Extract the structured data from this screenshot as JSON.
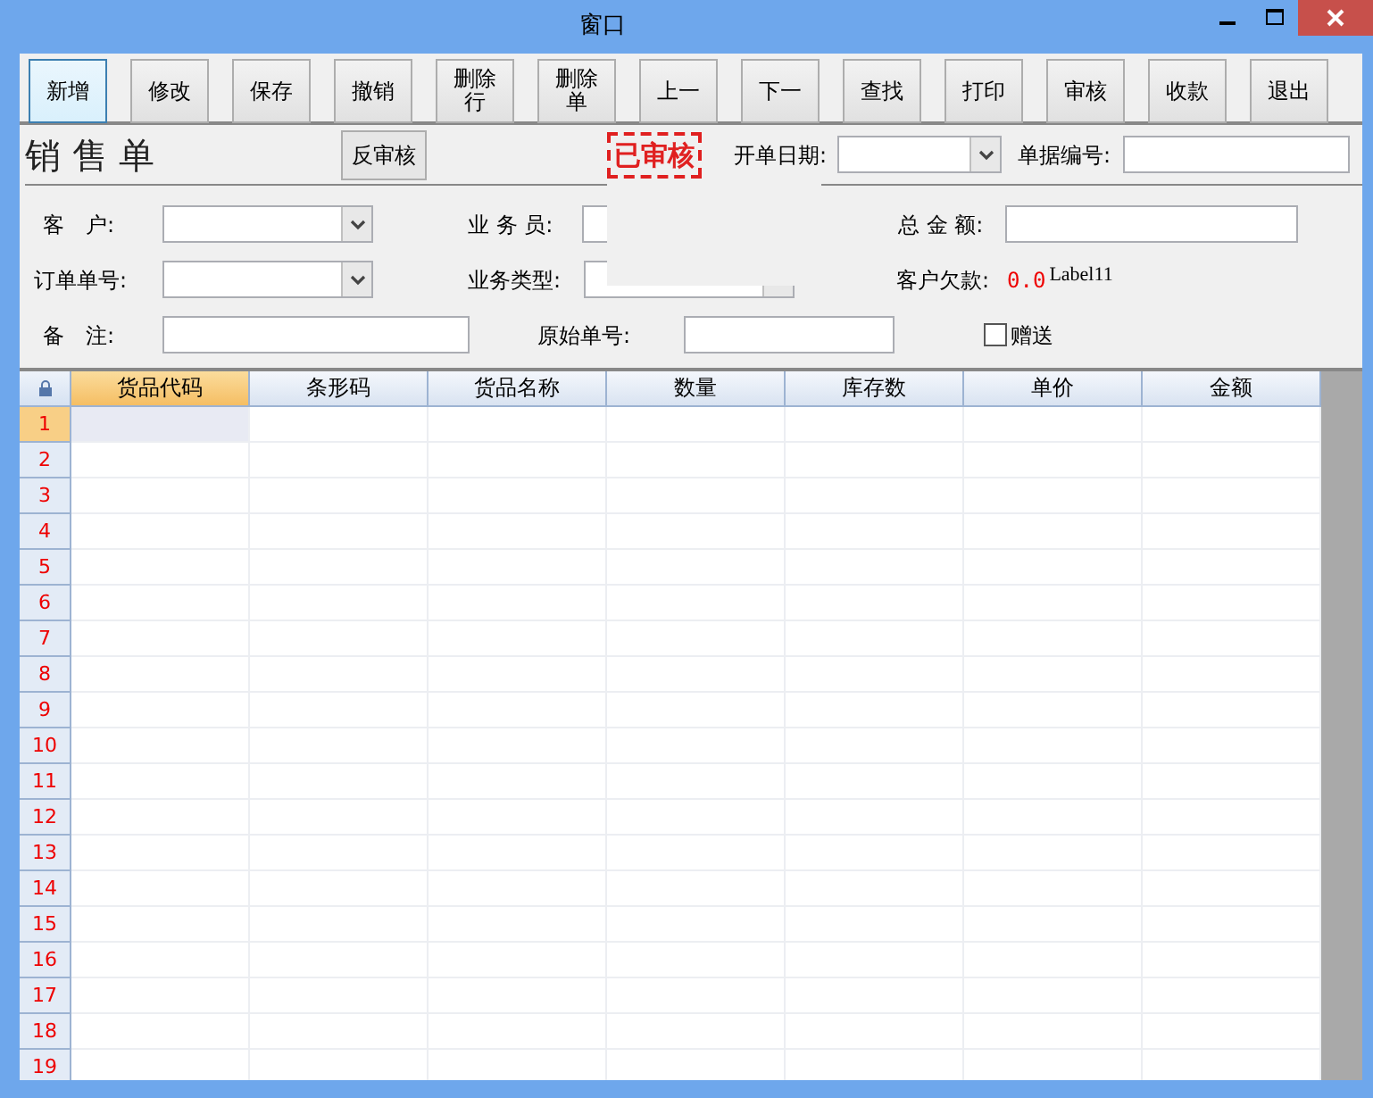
{
  "window": {
    "title": "窗口"
  },
  "toolbar": [
    {
      "label": "新增",
      "selected": true
    },
    {
      "label": "修改",
      "selected": false
    },
    {
      "label": "保存",
      "selected": false
    },
    {
      "label": "撤销",
      "selected": false
    },
    {
      "label": "删除行",
      "selected": false
    },
    {
      "label": "删除单",
      "selected": false
    },
    {
      "label": "上一",
      "selected": false
    },
    {
      "label": "下一",
      "selected": false
    },
    {
      "label": "查找",
      "selected": false
    },
    {
      "label": "打印",
      "selected": false
    },
    {
      "label": "审核",
      "selected": false
    },
    {
      "label": "收款",
      "selected": false
    },
    {
      "label": "退出",
      "selected": false
    }
  ],
  "header": {
    "title": "销 售 单",
    "unapprove_button": "反审核",
    "stamp": "已审核",
    "date_label": "开单日期:",
    "number_label": "单据编号:"
  },
  "form_rows": [
    [
      {
        "kind": "label",
        "text": "客　户:"
      },
      {
        "kind": "combo"
      },
      {
        "kind": "label",
        "text": "业 务 员:"
      },
      {
        "kind": "text"
      },
      {
        "kind": "label",
        "text": "总 金 额:"
      },
      {
        "kind": "text"
      }
    ],
    [
      {
        "kind": "label",
        "text": "订单单号:"
      },
      {
        "kind": "combo"
      },
      {
        "kind": "label",
        "text": "业务类型:"
      },
      {
        "kind": "combo"
      },
      {
        "kind": "label",
        "text": "客户欠款:"
      },
      {
        "kind": "value",
        "text": "0.0"
      },
      {
        "kind": "note",
        "text": "Label11"
      }
    ],
    [
      {
        "kind": "label",
        "text": "备　注:"
      },
      {
        "kind": "text"
      },
      {
        "kind": "label",
        "text": "原始单号:"
      },
      {
        "kind": "text"
      },
      {
        "kind": "checkbox",
        "text": "赠送",
        "checked": false
      }
    ]
  ],
  "table": {
    "columns": [
      {
        "label": "货品代码",
        "selected": true
      },
      {
        "label": "条形码",
        "selected": false
      },
      {
        "label": "货品名称",
        "selected": false
      },
      {
        "label": "数量",
        "selected": false
      },
      {
        "label": "库存数",
        "selected": false
      },
      {
        "label": "单价",
        "selected": false
      },
      {
        "label": "金额",
        "selected": false
      }
    ],
    "rows": [
      {
        "number": "1",
        "selected": true
      },
      {
        "number": "2",
        "selected": false
      },
      {
        "number": "3",
        "selected": false
      },
      {
        "number": "4",
        "selected": false
      },
      {
        "number": "5",
        "selected": false
      },
      {
        "number": "6",
        "selected": false
      },
      {
        "number": "7",
        "selected": false
      },
      {
        "number": "8",
        "selected": false
      },
      {
        "number": "9",
        "selected": false
      },
      {
        "number": "10",
        "selected": false
      },
      {
        "number": "11",
        "selected": false
      },
      {
        "number": "12",
        "selected": false
      },
      {
        "number": "13",
        "selected": false
      },
      {
        "number": "14",
        "selected": false
      },
      {
        "number": "15",
        "selected": false
      },
      {
        "number": "16",
        "selected": false
      },
      {
        "number": "17",
        "selected": false
      },
      {
        "number": "18",
        "selected": false
      },
      {
        "number": "19",
        "selected": false
      }
    ]
  }
}
